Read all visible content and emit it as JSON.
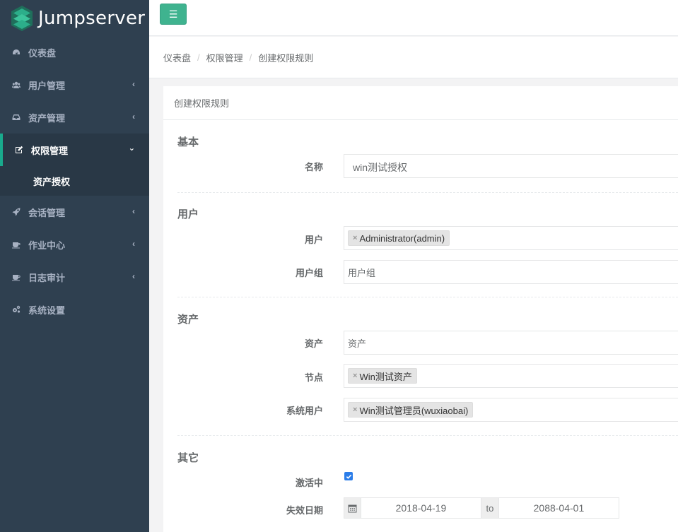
{
  "app": {
    "logo_text": "Jumpserver"
  },
  "sidebar": {
    "items": [
      {
        "label": "仪表盘",
        "icon": "dashboard-icon",
        "has_chevron": false
      },
      {
        "label": "用户管理",
        "icon": "users-icon",
        "has_chevron": true
      },
      {
        "label": "资产管理",
        "icon": "inbox-icon",
        "has_chevron": true
      },
      {
        "label": "权限管理",
        "icon": "edit-icon",
        "has_chevron": true,
        "active": true
      },
      {
        "label": "会话管理",
        "icon": "rocket-icon",
        "has_chevron": true
      },
      {
        "label": "作业中心",
        "icon": "coffee-icon",
        "has_chevron": true
      },
      {
        "label": "日志审计",
        "icon": "coffee-icon",
        "has_chevron": true
      },
      {
        "label": "系统设置",
        "icon": "gears-icon",
        "has_chevron": false
      }
    ],
    "subitems": [
      {
        "label": "资产授权"
      }
    ]
  },
  "breadcrumb": [
    "仪表盘",
    "权限管理",
    "创建权限规则"
  ],
  "panel": {
    "title": "创建权限规则",
    "sections": {
      "basic": "基本",
      "user": "用户",
      "asset": "资产",
      "other": "其它"
    },
    "fields": {
      "name": {
        "label": "名称",
        "value": "win测试授权"
      },
      "users": {
        "label": "用户",
        "tag": "Administrator(admin)"
      },
      "user_groups": {
        "label": "用户组",
        "placeholder": "用户组"
      },
      "assets": {
        "label": "资产",
        "placeholder": "资产"
      },
      "nodes": {
        "label": "节点",
        "tag": "Win测试资产"
      },
      "system_users": {
        "label": "系统用户",
        "tag": "Win测试管理员(wuxiaobai)"
      },
      "active": {
        "label": "激活中",
        "checked": true
      },
      "expire": {
        "label": "失效日期",
        "start": "2018-04-19",
        "to": "to",
        "end": "2088-04-01"
      }
    },
    "tag_remove_glyph": "×"
  },
  "colors": {
    "sidebar_bg": "#2f4050",
    "sidebar_active_bg": "#293846",
    "accent": "#19aa8d",
    "menu_button": "#3fb38f",
    "checkbox": "#2b7de9"
  }
}
